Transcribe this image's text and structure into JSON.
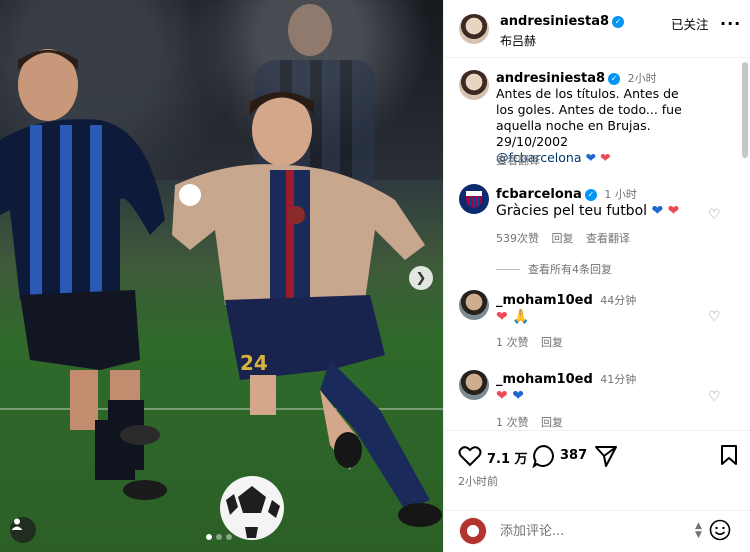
{
  "photo": {
    "caption": "Antes de los títulos. Antes de los goles. Antes de todo... fue aquella noche en Brujas. 29/10/2002",
    "jersey_number": "24"
  },
  "header": {
    "username": "andresiniesta8",
    "subtitle": "布吕赫",
    "follow_state": "已关注",
    "more": "..."
  },
  "post": {
    "username": "andresiniesta8",
    "time": "2小时",
    "caption": "Antes de los títulos. Antes de los goles. Antes de todo... fue aquella noche en Brujas. 29/10/2002",
    "mention": "@fcbarcelona",
    "translate": "查看翻译"
  },
  "comments": [
    {
      "username": "fcbarcelona",
      "time": "1 小时",
      "text": "Gràcies pel teu futbol",
      "likes": "539次赞",
      "reply": "回复",
      "translate": "查看翻译",
      "view_replies": "查看所有4条回复"
    },
    {
      "username": "_moham10ed",
      "time": "44分钟",
      "likes": "1 次赞",
      "reply": "回复"
    },
    {
      "username": "_moham10ed",
      "time": "41分钟",
      "likes": "1 次赞",
      "reply": "回复"
    }
  ],
  "actions": {
    "likes_count": "7.1 万",
    "comments_count": "387",
    "timestamp": "2小时前"
  },
  "add_comment": {
    "placeholder": "添加评论..."
  },
  "icons": {
    "heart": "heart-icon",
    "comment": "comment-icon",
    "share": "paper-plane-icon",
    "save": "bookmark-icon",
    "emoji": "emoji-icon",
    "next": "chevron-right-icon"
  },
  "colors": {
    "verified": "#0095f6",
    "link": "#00376b",
    "heart_red": "#ed4956",
    "heart_blue": "#1f66d1"
  }
}
